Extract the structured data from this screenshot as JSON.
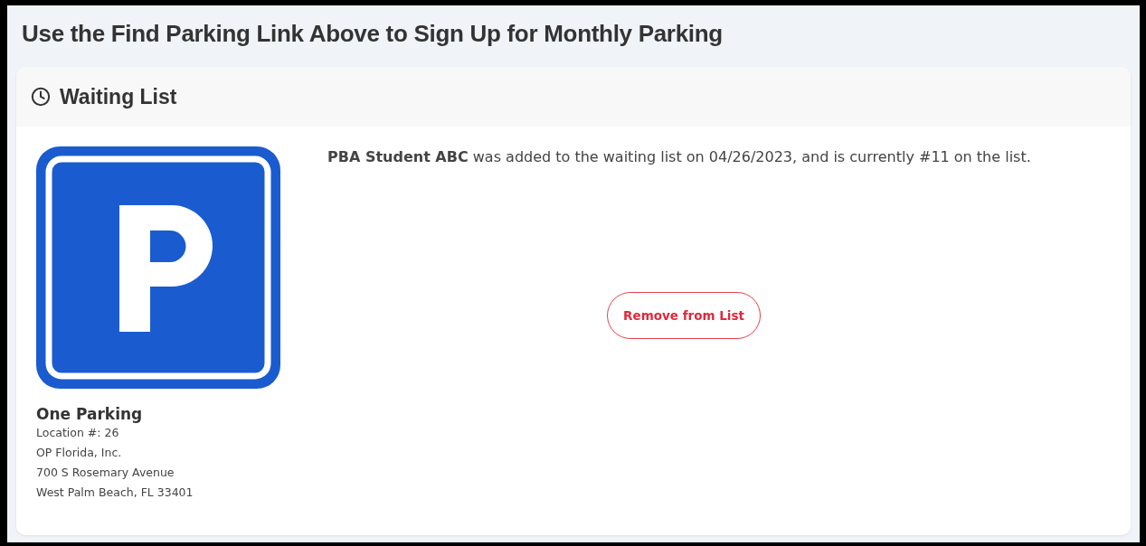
{
  "page_title": "Use the Find Parking Link Above to Sign Up for Monthly Parking",
  "card": {
    "title": "Waiting List",
    "location": {
      "name": "One Parking",
      "lines": [
        "Location #: 26",
        "OP Florida, Inc.",
        "700 S Rosemary Avenue",
        "West Palm Beach, FL 33401"
      ]
    },
    "message": "**PBA Student ABC** was added to the waiting list on 04/26/2023, and is currently #11 on the list.",
    "button": "Remove from List"
  }
}
